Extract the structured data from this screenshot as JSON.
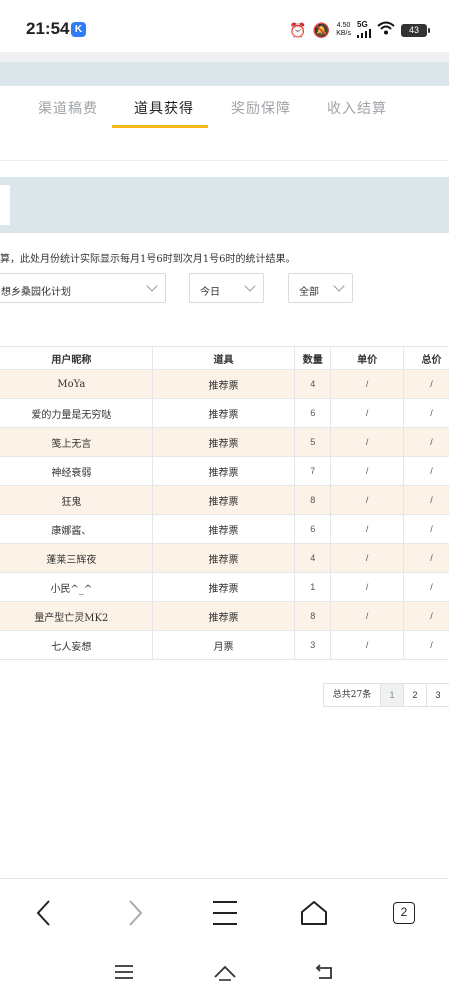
{
  "status_bar": {
    "time": "21:54",
    "app_badge": "K",
    "net_speed_top": "4.50",
    "net_speed_bottom": "KB/s",
    "signal_label": "5G",
    "battery": "43"
  },
  "tabs": [
    {
      "label": "渠道稿费",
      "active": false
    },
    {
      "label": "道具获得",
      "active": true
    },
    {
      "label": "奖励保障",
      "active": false
    },
    {
      "label": "收入结算",
      "active": false
    }
  ],
  "note": "算，此处月份统计实际显示每月1号6时到次月1号6时的统计结果。",
  "filters": {
    "book": "想乡桑园化计划",
    "date": "今日",
    "type": "全部"
  },
  "table": {
    "headers": [
      "用户昵称",
      "道具",
      "数量",
      "单价",
      "总价"
    ],
    "rows": [
      [
        "MoYa",
        "推荐票",
        "4",
        "/",
        "/"
      ],
      [
        "爱的力量是无穷哒",
        "推荐票",
        "6",
        "/",
        "/"
      ],
      [
        "笺上无言",
        "推荐票",
        "5",
        "/",
        "/"
      ],
      [
        "神经衰弱",
        "推荐票",
        "7",
        "/",
        "/"
      ],
      [
        "狂鬼",
        "推荐票",
        "8",
        "/",
        "/"
      ],
      [
        "康娜酱、",
        "推荐票",
        "6",
        "/",
        "/"
      ],
      [
        "蓬莱三辉夜",
        "推荐票",
        "4",
        "/",
        "/"
      ],
      [
        "小民^_^",
        "推荐票",
        "1",
        "/",
        "/"
      ],
      [
        "量产型亡灵MK2",
        "推荐票",
        "8",
        "/",
        "/"
      ],
      [
        "七人妄想",
        "月票",
        "3",
        "/",
        "/"
      ]
    ]
  },
  "pagination": {
    "total": "总共27条",
    "pages": [
      "1",
      "2",
      "3"
    ],
    "current": "1"
  },
  "browser_nav": {
    "tab_count": "2",
    "icons": [
      "back-icon",
      "forward-icon",
      "menu-icon",
      "home-icon",
      "tabs-icon"
    ]
  },
  "system_nav": {
    "icons": [
      "recent-apps-icon",
      "home-icon",
      "back-icon"
    ]
  }
}
